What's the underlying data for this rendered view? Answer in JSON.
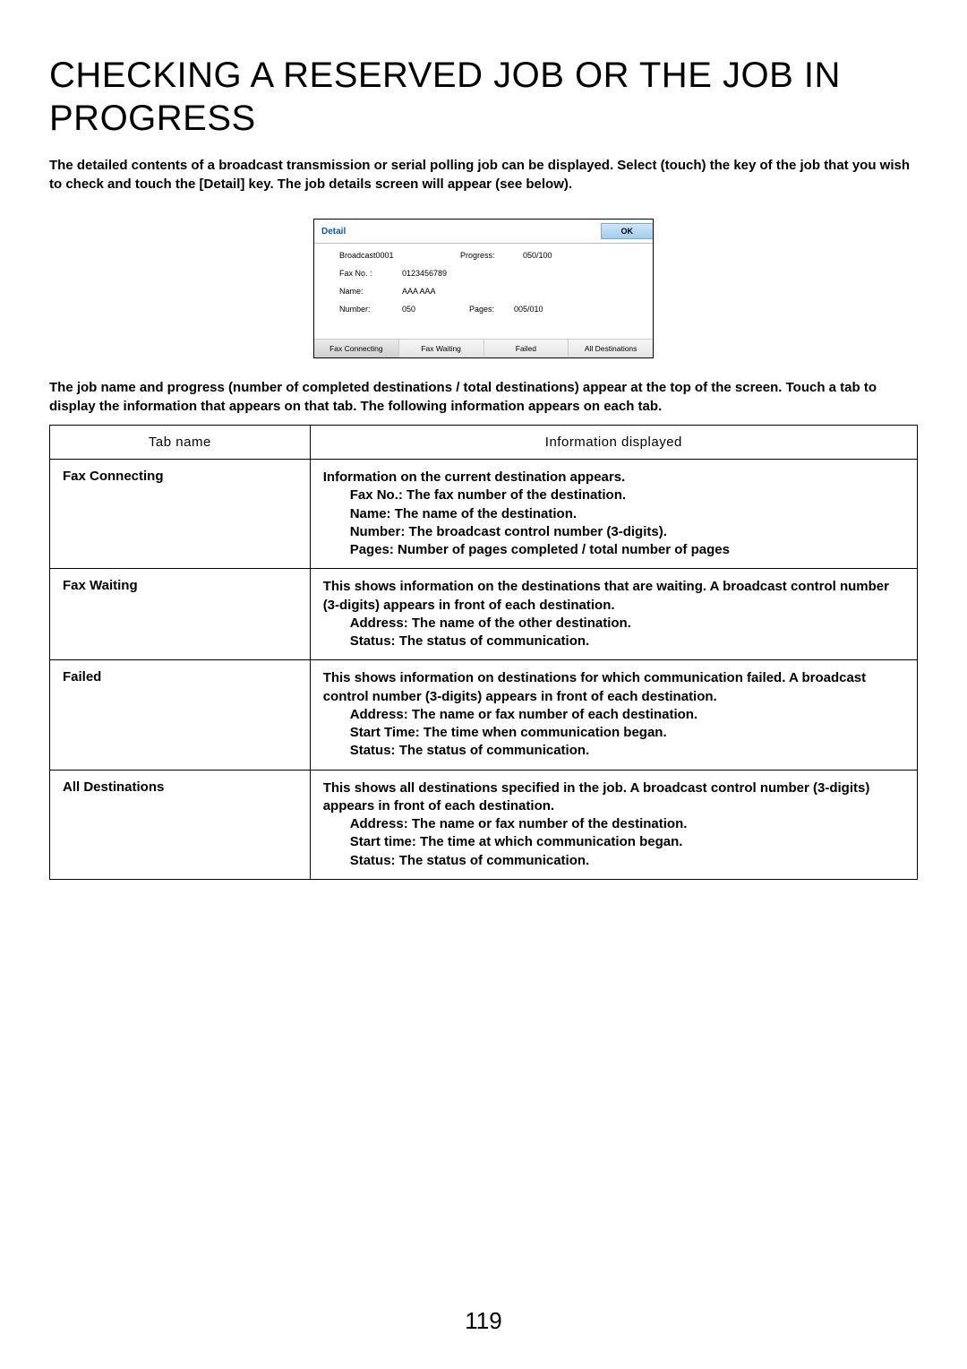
{
  "title": "CHECKING A RESERVED JOB OR THE JOB IN PROGRESS",
  "intro": "The detailed contents of a broadcast transmission or serial polling job can be displayed. Select (touch) the key of the job that you wish to check and touch the [Detail] key. The job details screen will appear (see below).",
  "panel": {
    "header": "Detail",
    "ok": "OK",
    "job_name": "Broadcast0001",
    "progress_label": "Progress:",
    "progress_value": "050/100",
    "faxno_label": "Fax No. :",
    "faxno_value": "0123456789",
    "name_label": "Name:",
    "name_value": "AAA AAA",
    "number_label": "Number:",
    "number_value": "050",
    "pages_label": "Pages:",
    "pages_value": "005/010",
    "tabs": [
      "Fax Connecting",
      "Fax Waiting",
      "Failed",
      "All Destinations"
    ]
  },
  "desc": "The job name and progress (number of completed destinations / total destinations) appear at the top of the screen. Touch a tab to display the information that appears on that tab. The following information appears on each tab.",
  "table": {
    "head": {
      "col1": "Tab name",
      "col2": "Information displayed"
    },
    "rows": [
      {
        "name": "Fax Connecting",
        "lead": "Information on the current destination appears.",
        "bullets": [
          "Fax No.: The fax number of the destination.",
          "Name: The name of the destination.",
          "Number: The broadcast control number (3-digits).",
          "Pages: Number of pages completed / total number of pages"
        ]
      },
      {
        "name": "Fax Waiting",
        "lead": "This shows information on the destinations that are waiting. A broadcast control number (3-digits) appears in front of each destination.",
        "bullets": [
          "Address: The name of the other destination.",
          "Status: The status of communication."
        ]
      },
      {
        "name": "Failed",
        "lead": "This shows information on destinations for which communication failed. A broadcast control number (3-digits) appears in front of each destination.",
        "bullets": [
          "Address: The name or fax number of each destination.",
          "Start Time: The time when communication began.",
          "Status: The status of communication."
        ]
      },
      {
        "name": "All Destinations",
        "lead": "This shows all destinations specified in the job. A broadcast control number (3-digits) appears in front of each destination.",
        "bullets": [
          "Address: The name or fax number of the destination.",
          "Start time: The time at which communication began.",
          "Status: The status of communication."
        ]
      }
    ]
  },
  "pageno": "119"
}
